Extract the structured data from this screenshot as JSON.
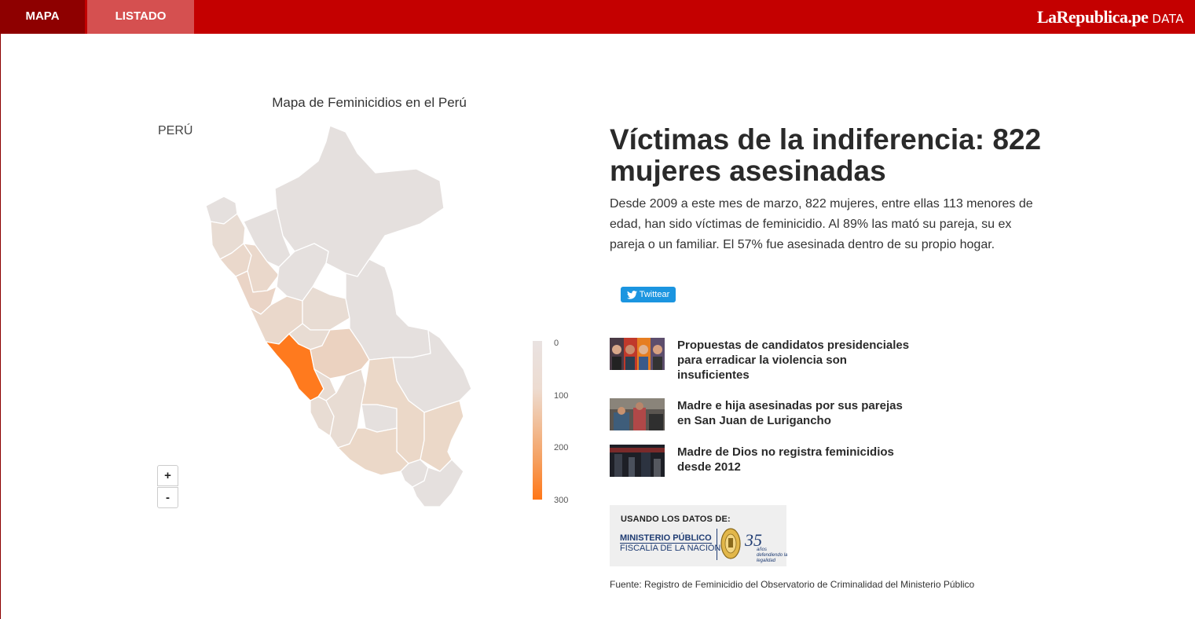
{
  "nav": {
    "tabs": [
      {
        "label": "MAPA",
        "active": true
      },
      {
        "label": "LISTADO",
        "active": false
      }
    ],
    "brand": {
      "name": "LaRepublica.pe",
      "section": "DATA"
    }
  },
  "map": {
    "title": "Mapa de Feminicidios en el Perú",
    "country_label": "PERÚ",
    "zoom_in": "+",
    "zoom_out": "-",
    "legend": {
      "ticks": [
        "0",
        "100",
        "200",
        "300"
      ],
      "min_color": "#e9e2e1",
      "max_color": "#ff7718"
    }
  },
  "article": {
    "headline": "Víctimas de la indiferencia: 822 mujeres asesinadas",
    "intro": "Desde 2009 a este mes de marzo, 822 mujeres, entre ellas 113 menores de edad, han sido víctimas de feminicidio. Al 89% las mató su pareja, su ex pareja o un familiar. El 57% fue asesinada dentro de su propio hogar.",
    "tweet_label": "Twittear"
  },
  "related": [
    {
      "title": "Propuestas de candidatos presidenciales para erradicar la violencia son insuficientes"
    },
    {
      "title": "Madre e hija asesinadas por sus parejas en San Juan de Lurigancho"
    },
    {
      "title": "Madre de Dios no registra feminicidios desde 2012"
    }
  ],
  "source": {
    "label": "USANDO LOS DATOS DE:",
    "org_line1": "MINISTERIO PÚBLICO",
    "org_line2": "FISCALÍA DE LA NACIÓN",
    "anniversary": "35",
    "anniversary_sub": "años defendiendo la legalidad",
    "fuente": "Fuente: Registro de Feminicidio del Observatorio de Criminalidad del Ministerio Público"
  },
  "colors": {
    "brand_red": "#c40000",
    "active_tab": "#8e0000",
    "tab": "#d55050",
    "twitter": "#1b95e0",
    "lima": "#ff7a1e"
  }
}
